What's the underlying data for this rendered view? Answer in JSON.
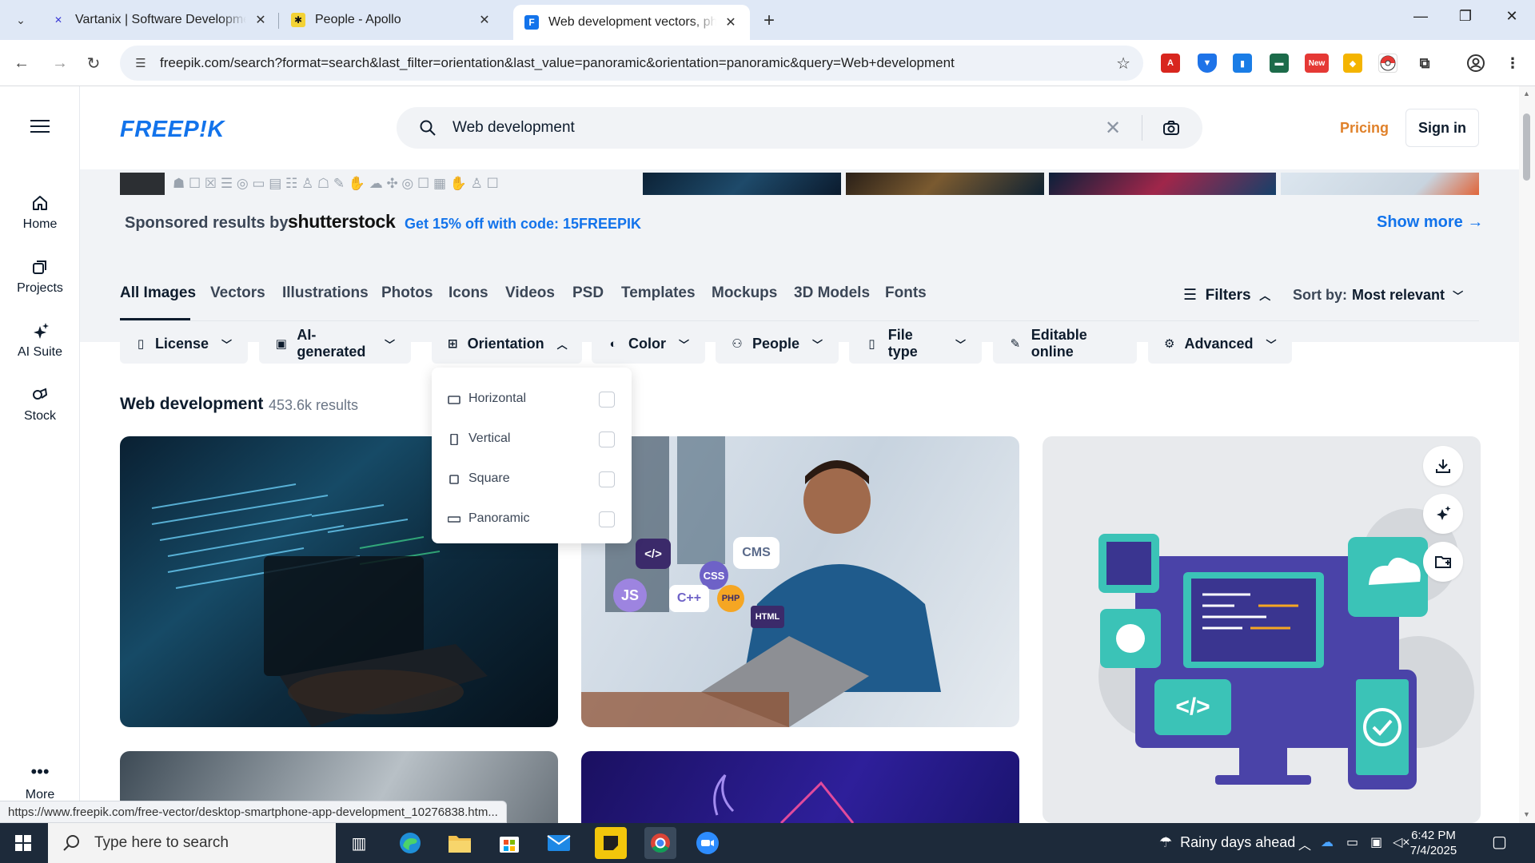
{
  "browser": {
    "tabs": [
      {
        "title": "Vartanix | Software Development",
        "icon": "vartanix-x-icon"
      },
      {
        "title": "People - Apollo",
        "icon": "apollo-asterisk-icon"
      },
      {
        "title": "Web development vectors, pho",
        "icon": "freepik-icon"
      }
    ],
    "url": "freepik.com/search?format=search&last_filter=orientation&last_value=panoramic&orientation=panoramic&query=Web+development",
    "ext_badge": "New"
  },
  "sidebar": {
    "items": [
      {
        "label": "Home",
        "icon": "home-icon"
      },
      {
        "label": "Projects",
        "icon": "projects-icon"
      },
      {
        "label": "AI Suite",
        "icon": "sparkle-icon"
      },
      {
        "label": "Stock",
        "icon": "stock-icon"
      }
    ],
    "more_label": "More"
  },
  "header": {
    "logo": "FREEP!K",
    "search_value": "Web development",
    "pricing": "Pricing",
    "signin": "Sign in"
  },
  "sponsored": {
    "label": "Sponsored results by",
    "brand": "shutterstock",
    "promo": "Get 15% off with code: 15FREEPIK",
    "show_more": "Show more →"
  },
  "categories": [
    "All Images",
    "Vectors",
    "Illustrations",
    "Photos",
    "Icons",
    "Videos",
    "PSD",
    "Templates",
    "Mockups",
    "3D Models",
    "Fonts"
  ],
  "filters_label": "Filters",
  "sort": {
    "label": "Sort by:",
    "value": "Most relevant"
  },
  "filter_buttons": [
    {
      "label": "License",
      "icon": "license-icon"
    },
    {
      "label": "AI-generated",
      "icon": "ai-icon"
    },
    {
      "label": "Orientation",
      "icon": "orientation-icon"
    },
    {
      "label": "Color",
      "icon": "palette-icon"
    },
    {
      "label": "People",
      "icon": "people-icon"
    },
    {
      "label": "File type",
      "icon": "file-icon"
    },
    {
      "label": "Editable online",
      "icon": "pen-icon"
    },
    {
      "label": "Advanced",
      "icon": "gear-icon"
    }
  ],
  "orientation_options": [
    "Horizontal",
    "Vertical",
    "Square",
    "Panoramic"
  ],
  "results": {
    "title": "Web development",
    "count": "453.6k results"
  },
  "card_badges": {
    "tags": [
      "</>",
      "CMS",
      "CSS",
      "JS",
      "C++",
      "PHP",
      "HTML"
    ]
  },
  "status_url": "https://www.freepik.com/free-vector/desktop-smartphone-app-development_10276838.htm...",
  "taskbar": {
    "search_placeholder": "Type here to search",
    "weather": "Rainy days ahead",
    "time": "6:42 PM",
    "date": "7/4/2025"
  },
  "colors": {
    "accent": "#1273eb",
    "pricing": "#e0812a",
    "text": "#0e1c2d"
  }
}
